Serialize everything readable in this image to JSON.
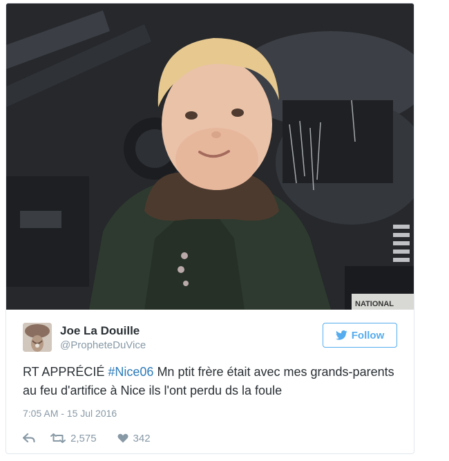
{
  "tweet": {
    "author_name": "Joe La Douille",
    "author_handle": "@PropheteDuVice",
    "follow_label": "Follow",
    "text_before": "RT APPRÉCIÉ ",
    "hashtag": "#Nice06",
    "text_after": " Mn ptit frère était avec mes grands-parents au feu d'artifice à Nice ils l'ont perdu ds la foule",
    "timestamp": "7:05 AM - 15 Jul 2016",
    "retweet_count": "2,575",
    "like_count": "342"
  },
  "photo": {
    "sign_text": "NATIONAL"
  },
  "colors": {
    "accent": "#55acee",
    "hashtag": "#2b7bb9",
    "text": "#292f33",
    "muted": "#8899a6",
    "border": "#e1e8ed"
  },
  "icons": {
    "follow": "bird-icon",
    "reply": "reply-icon",
    "retweet": "retweet-icon",
    "like": "heart-icon"
  }
}
